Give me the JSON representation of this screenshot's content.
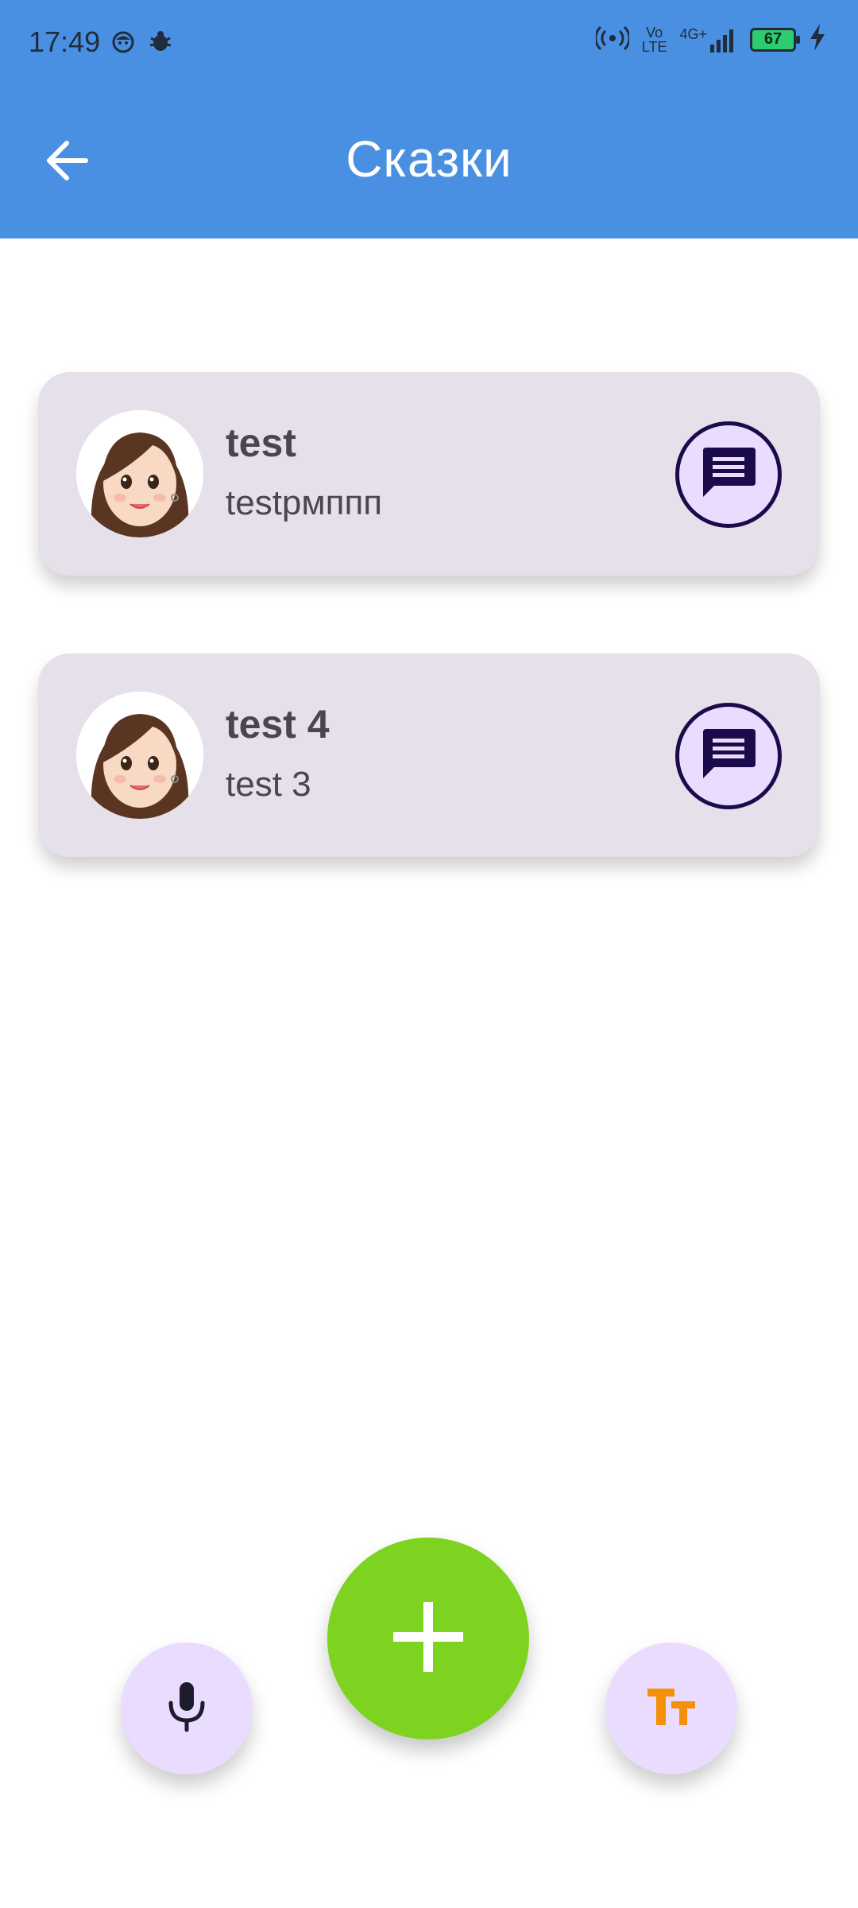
{
  "status_bar": {
    "time": "17:49",
    "vo_top": "Vo",
    "vo_bottom": "LTE",
    "network": "4G+",
    "battery": "67",
    "icons": [
      "face-icon",
      "bug-icon",
      "hotspot-icon",
      "volte-icon",
      "signal-icon",
      "battery-icon",
      "charging-icon"
    ]
  },
  "header": {
    "title": "Сказки",
    "back_icon": "arrow-left-icon"
  },
  "stories": [
    {
      "title": "test",
      "subtitle": "testрмппп",
      "action_icon": "chat-icon"
    },
    {
      "title": "test 4",
      "subtitle": "test 3",
      "action_icon": "chat-icon"
    }
  ],
  "actions": {
    "add_icon": "plus-icon",
    "mic_icon": "mic-icon",
    "text_size_icon": "text-size-icon"
  },
  "colors": {
    "header": "#4a90e2",
    "card": "#e6e0ea",
    "fab_main": "#7ed321",
    "fab_small": "#eadcff",
    "accent_dark": "#1c0b4a",
    "text_size_icon": "#f5900a"
  }
}
